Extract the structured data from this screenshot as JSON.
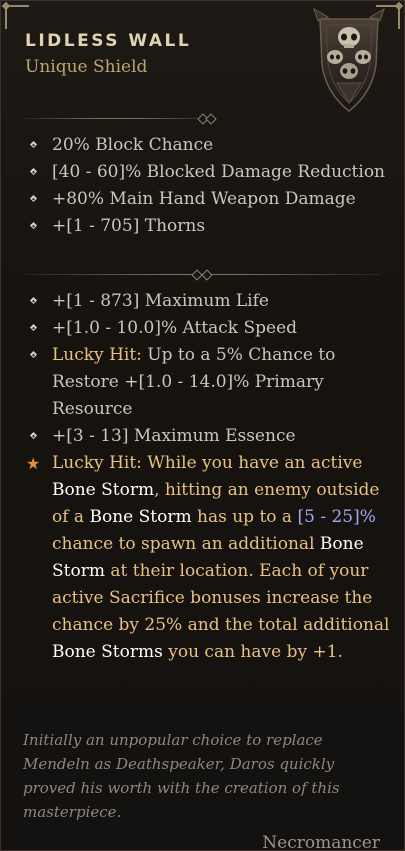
{
  "item": {
    "name": "LIDLESS WALL",
    "type": "Unique Shield"
  },
  "base_stats": [
    "20% Block Chance",
    "[40 - 60]% Blocked Damage Reduction",
    "+80% Main Hand Weapon Damage",
    "+[1 - 705] Thorns"
  ],
  "affixes": [
    "+[1 - 873] Maximum Life",
    "+[1.0 - 10.0]% Attack Speed",
    "Up to a 5% Chance to Restore +[1.0 - 14.0]% Primary Resource",
    "+[3 - 13] Maximum Essence"
  ],
  "lucky_hit_label": "Lucky Hit:",
  "unique_power": {
    "label": "Lucky Hit:",
    "t1": " While you have an active ",
    "k1": "Bone Storm",
    "t2": ", hitting an enemy outside of a ",
    "k2": "Bone Storm",
    "t3": " has up to a ",
    "range": "[5 - 25]%",
    "t4": " chance to spawn an additional ",
    "k3": "Bone Storm",
    "t5": " at their location. Each of your active Sacrifice bonuses increase the chance by 25% and the total additional ",
    "k4": "Bone Storms",
    "t6": " you can have by +1."
  },
  "flavor_text": "Initially an unpopular choice to replace Mendeln as Deathspeaker, Daros quickly proved his worth with the creation of this masterpiece.",
  "class_requirement": "Necromancer",
  "colors": {
    "name": "#e0d2b2",
    "type": "#bda56f",
    "unique_power": "#e8c182",
    "keyword": "#ffffff",
    "range": "#a9a6ee",
    "star": "#e2913e",
    "flavor": "#8c8781"
  },
  "icons": {
    "item_art": "shield-skull-icon",
    "bullet": "diamond-bullet-icon",
    "unique": "star-icon"
  }
}
